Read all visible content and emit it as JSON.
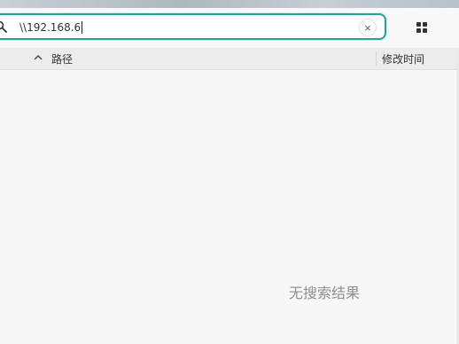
{
  "search": {
    "query": "\\\\192.168.6",
    "clear_symbol": "×"
  },
  "icons": {
    "search": "search-icon",
    "clear": "close-icon",
    "view": "grid-view-icon",
    "sort": "chevron-up-icon"
  },
  "columns": {
    "path": "路径",
    "modified": "修改时间"
  },
  "results": {
    "empty_message": "无搜索结果"
  },
  "colors": {
    "accent": "#2aa198"
  }
}
